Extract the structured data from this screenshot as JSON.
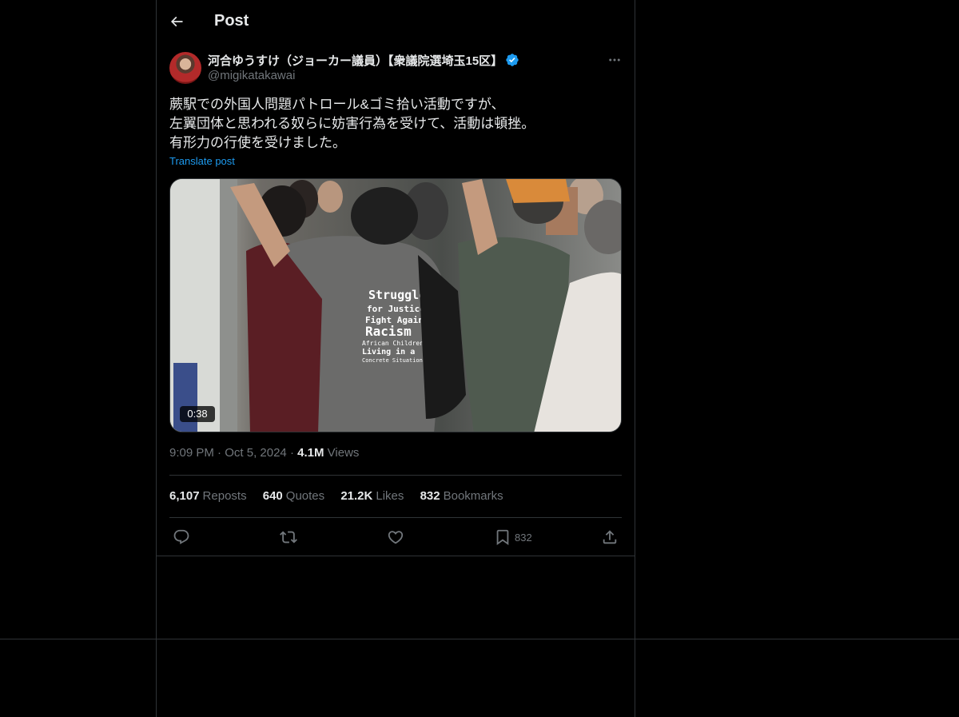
{
  "header": {
    "title": "Post"
  },
  "author": {
    "name": "河合ゆうすけ（ジョーカー議員）【衆議院選埼玉15区】",
    "handle": "@migikatakawai"
  },
  "post": {
    "lines": [
      "蕨駅での外国人問題パトロール&ゴミ拾い活動ですが、",
      "左翼団体と思われる奴らに妨害行為を受けて、活動は頓挫。",
      "有形力の行使を受けました。"
    ],
    "translate_label": "Translate post",
    "video": {
      "duration": "0:38",
      "shirt_text": [
        "Struggle",
        "for Justice",
        "Fight Against",
        "Racism",
        "African Children",
        "Living in a",
        "Concrete Situation"
      ]
    }
  },
  "meta": {
    "time": "9:09 PM",
    "date": "Oct 5, 2024",
    "separator": "·",
    "views_count": "4.1M",
    "views_label": "Views"
  },
  "stats": {
    "reposts_count": "6,107",
    "reposts_label": "Reposts",
    "quotes_count": "640",
    "quotes_label": "Quotes",
    "likes_count": "21.2K",
    "likes_label": "Likes",
    "bookmarks_count": "832",
    "bookmarks_label": "Bookmarks"
  },
  "actions": {
    "bookmark_count": "832"
  },
  "colors": {
    "background": "#000000",
    "border": "#2f3336",
    "text_primary": "#e7e9ea",
    "text_secondary": "#71767b",
    "accent": "#1d9bf0"
  },
  "icons": [
    "back-arrow-icon",
    "verified-badge-icon",
    "more-icon",
    "reply-icon",
    "repost-icon",
    "like-icon",
    "bookmark-icon",
    "share-icon"
  ]
}
